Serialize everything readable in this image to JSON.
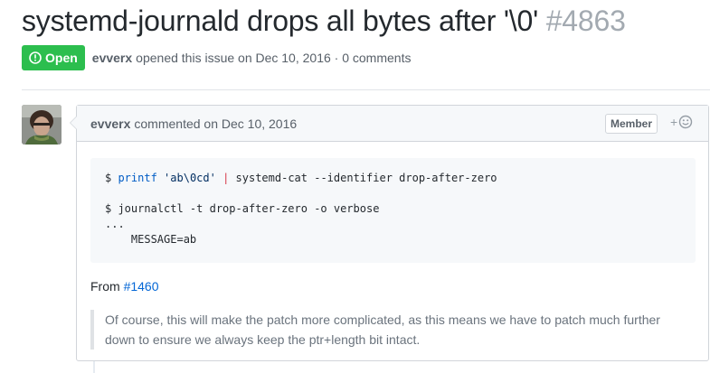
{
  "issue": {
    "title": "systemd-journald drops all bytes after '\\0'",
    "number": "#4863",
    "state_label": "Open",
    "author": "evverx",
    "opened_text": "opened this issue on Dec 10, 2016 · 0 comments"
  },
  "comment": {
    "author": "evverx",
    "meta_text": "commented on Dec 10, 2016",
    "role_badge": "Member",
    "reaction_plus": "+",
    "code": {
      "l1_prompt": "$ ",
      "l1_cmd": "printf",
      "l1_arg": "'ab\\0cd'",
      "l1_pipe": "|",
      "l1_rest": " systemd-cat --identifier drop-after-zero",
      "l3": "$ journalctl -t drop-after-zero -o verbose",
      "l4": "...",
      "l5": "    MESSAGE=ab"
    },
    "from_label": "From",
    "from_link": "#1460",
    "quote": "Of course, this will make the patch more complicated, as this means we have to patch much further down to ensure we always keep the ptr+length bit intact."
  },
  "colors": {
    "open_green": "#2cbe4e",
    "link_blue": "#0366d6",
    "border": "#d1d5da",
    "header_bg": "#f6f8fa"
  },
  "icons": {
    "state": "issue-opened-icon",
    "reaction": "smiley-icon"
  }
}
